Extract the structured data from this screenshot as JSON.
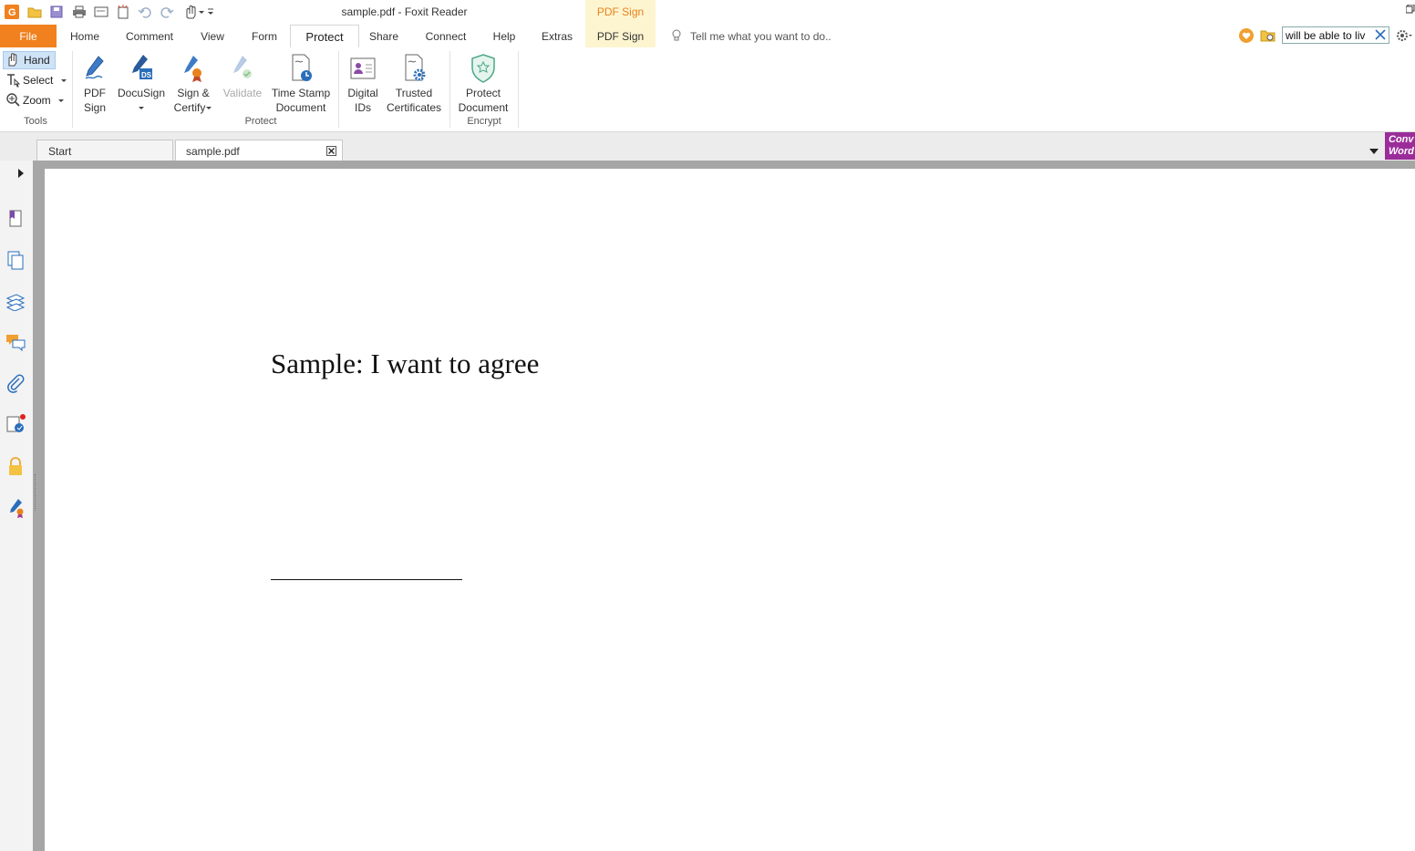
{
  "window": {
    "title": "sample.pdf - Foxit Reader",
    "context_tab_label": "PDF Sign"
  },
  "menu": {
    "tabs": [
      {
        "label": "File"
      },
      {
        "label": "Home"
      },
      {
        "label": "Comment"
      },
      {
        "label": "View"
      },
      {
        "label": "Form"
      },
      {
        "label": "Protect"
      },
      {
        "label": "Share"
      },
      {
        "label": "Connect"
      },
      {
        "label": "Help"
      },
      {
        "label": "Extras"
      },
      {
        "label": "PDF Sign"
      }
    ],
    "active_tab": "Protect",
    "tell_me_placeholder": "Tell me what you want to do..",
    "search_value": "will be able to liv"
  },
  "ribbon": {
    "tools": {
      "items": [
        {
          "label": "Hand"
        },
        {
          "label": "Select"
        },
        {
          "label": "Zoom"
        }
      ],
      "group_label": "Tools"
    },
    "protect": {
      "buttons": [
        {
          "line1": "PDF",
          "line2": "Sign"
        },
        {
          "line1": "DocuSign",
          "line2": ""
        },
        {
          "line1": "Sign &",
          "line2": "Certify"
        },
        {
          "line1": "Validate",
          "line2": ""
        },
        {
          "line1": "Time Stamp",
          "line2": "Document"
        },
        {
          "line1": "Digital",
          "line2": "IDs"
        },
        {
          "line1": "Trusted",
          "line2": "Certificates"
        }
      ],
      "group_label": "Protect"
    },
    "encrypt": {
      "buttons": [
        {
          "line1": "Protect",
          "line2": "Document"
        }
      ],
      "group_label": "Encrypt"
    }
  },
  "doc_tabs": [
    {
      "label": "Start"
    },
    {
      "label": "sample.pdf"
    }
  ],
  "convert_badge": {
    "line1": "Conv",
    "line2": "Word"
  },
  "document": {
    "text": "Sample: I want to agree"
  },
  "colors": {
    "accent": "#f0811e",
    "convert": "#9b2d9a",
    "frame": "#a6a6a6"
  }
}
